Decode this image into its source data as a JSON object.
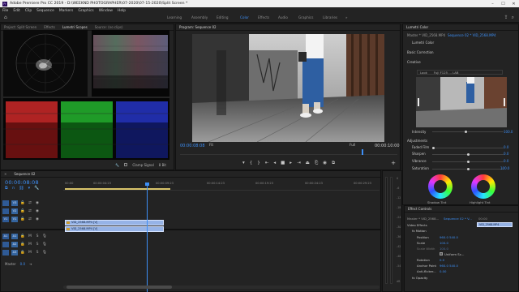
{
  "window": {
    "title": "Adobe Premiere Pro CC 2019 - D:\\WEEKND PHOTOGRAPHER\\07-2020\\07-15-2020\\Split Screen *",
    "app_icon": "Pr",
    "controls": [
      "minimize-icon",
      "maximize-icon",
      "close-icon"
    ]
  },
  "menu": [
    "File",
    "Edit",
    "Clip",
    "Sequence",
    "Markers",
    "Graphics",
    "Window",
    "Help"
  ],
  "workspaces": {
    "items": [
      {
        "label": "Learning",
        "active": false
      },
      {
        "label": "Assembly",
        "active": false
      },
      {
        "label": "Editing",
        "active": false
      },
      {
        "label": "Color",
        "active": true
      },
      {
        "label": "Effects",
        "active": false
      },
      {
        "label": "Audio",
        "active": false
      },
      {
        "label": "Graphics",
        "active": false
      },
      {
        "label": "Libraries",
        "active": false
      }
    ],
    "more": "»"
  },
  "scopes_panel": {
    "tabs": [
      "Project: Split Screen",
      "Effects",
      "Lumetri Scopes",
      "Source: (no clips)"
    ],
    "active_tab": "Lumetri Scopes",
    "clamp_signal": "Clamp Signal",
    "bit_depth": "8 Bit"
  },
  "program": {
    "tab": "Program: Sequence 02",
    "timecode": "00:00:08:08",
    "fit": "Fit",
    "resolution": "Full",
    "duration": "00:00:10:00"
  },
  "lumetri": {
    "tab": "Lumetri Color",
    "master": "Master * VID_2568.MP4",
    "sequence": "Sequence 02 * VID_2568.MP4",
    "effect": "Lumetri Color",
    "basic_correction": "Basic Correction",
    "creative": "Creative",
    "look_label": "Look",
    "look_value": "Fuji F125 ... LAB",
    "intensity_label": "Intensity",
    "intensity_value": "100.0",
    "adjustments_label": "Adjustments",
    "adjustments": [
      {
        "label": "Faded Film",
        "value": "0.0",
        "knob": 0.0
      },
      {
        "label": "Sharpen",
        "value": "0.0",
        "knob": 0.5
      },
      {
        "label": "Vibrance",
        "value": "0.0",
        "knob": 0.5
      },
      {
        "label": "Saturation",
        "value": "100.0",
        "knob": 0.5
      }
    ],
    "wheels": [
      "Shadow Tint",
      "Highlight Tint"
    ]
  },
  "timeline": {
    "tab": "Sequence 02",
    "timecode": "00:00:08:08",
    "ticks": [
      "00:00",
      "00:00:04:23",
      "00:00:09:23",
      "00:00:14:23",
      "00:00:19:23",
      "00:00:24:23",
      "00:00:29:23"
    ],
    "tracks": [
      {
        "src": "",
        "tgt": "V3"
      },
      {
        "src": "",
        "tgt": "V2"
      },
      {
        "src": "V1",
        "tgt": "V1"
      },
      {
        "src": "A1",
        "tgt": "A1"
      },
      {
        "src": "",
        "tgt": "A2"
      },
      {
        "src": "",
        "tgt": "A3"
      }
    ],
    "clips": [
      "VID_2568.MP4 [V]",
      "VID_2568.MP4 [V]"
    ],
    "master_label": "Master",
    "master_value": "0.0"
  },
  "meters": {
    "scale": [
      "0",
      "-6",
      "-12",
      "-18",
      "-24",
      "-30",
      "-36",
      "-42",
      "-48",
      "-54",
      "dB"
    ]
  },
  "effect_controls": {
    "tab": "Effect Controls",
    "master": "Master * VID_2568...",
    "sequence": "Sequence 02 * V...",
    "ruler_time": "00:00",
    "clip": "VID_2568.MP4",
    "section": "Video Effects",
    "rows": [
      {
        "label": "fx  Motion",
        "value": ""
      },
      {
        "label": "Position",
        "value": "960.0  540.0"
      },
      {
        "label": "Scale",
        "value": "100.0"
      },
      {
        "label": "Scale Width",
        "value": "100.0"
      },
      {
        "label": "Uniform Sc...",
        "value": ""
      },
      {
        "label": "Rotation",
        "value": "0.0"
      },
      {
        "label": "Anchor Point",
        "value": "960.0  540.0"
      },
      {
        "label": "Anti-flicker...",
        "value": "0.00"
      },
      {
        "label": "fx  Opacity",
        "value": ""
      }
    ]
  }
}
